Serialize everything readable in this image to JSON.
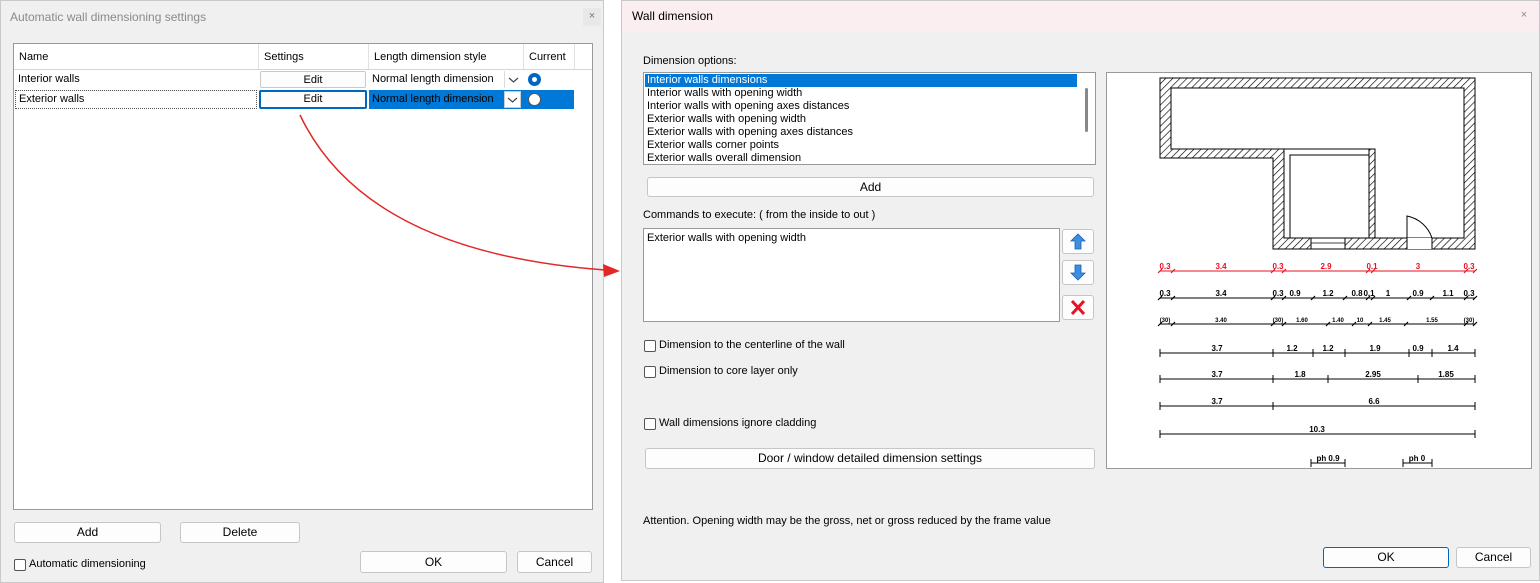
{
  "left": {
    "title": "Automatic wall dimensioning settings",
    "close": "×",
    "headers": [
      "Name",
      "Settings",
      "Length dimension style",
      "Current"
    ],
    "rows": [
      {
        "name": "Interior walls",
        "settings": "Edit",
        "style": "Normal length dimension",
        "current": true
      },
      {
        "name": "Exterior walls",
        "settings": "Edit",
        "style": "Normal length dimension",
        "current": false
      }
    ],
    "add": "Add",
    "delete": "Delete",
    "auto_dim": "Automatic dimensioning",
    "ok": "OK",
    "cancel": "Cancel"
  },
  "right": {
    "title": "Wall dimension",
    "close": "×",
    "dim_options_label": "Dimension options:",
    "options": [
      "Interior walls dimensions",
      "Interior walls with opening width",
      "Interior walls with opening axes distances",
      "Exterior walls with opening width",
      "Exterior walls with opening axes distances",
      "Exterior walls corner points",
      "Exterior walls overall dimension"
    ],
    "add": "Add",
    "commands_label": "Commands to execute: ( from the inside to out )",
    "commands": [
      "Exterior walls with opening width"
    ],
    "cb_centerline": "Dimension to the centerline of the wall",
    "cb_core": "Dimension to core layer only",
    "cb_cladding": "Wall dimensions ignore cladding",
    "door_window": "Door / window detailed dimension settings",
    "attention": "Attention. Opening width may be the gross, net or gross reduced by the frame value",
    "ok": "OK",
    "cancel": "Cancel"
  },
  "preview": {
    "row1": [
      "0.3",
      "3.4",
      "0.3",
      "2.9",
      "0.1",
      "3",
      "0.3"
    ],
    "row2": [
      "0.3",
      "3.4",
      "0.3",
      "0.9",
      "1.2",
      "0.8",
      "0.1",
      "1",
      "0.9",
      "1.1",
      "0.3"
    ],
    "row3": [
      "(30)",
      "3.40",
      "(30)",
      "1.60",
      "1.40",
      "10",
      "1.45",
      "1.55",
      "(30)"
    ],
    "row4": [
      "3.7",
      "1.2",
      "1.2",
      "1.9",
      "0.9",
      "1.4"
    ],
    "row5": [
      "3.7",
      "1.8",
      "2.95",
      "1.85"
    ],
    "row6": [
      "3.7",
      "6.6"
    ],
    "row7": [
      "10.3"
    ],
    "ph": [
      "ph 0.9",
      "ph 0"
    ]
  },
  "colors": {
    "accent": "#0078d7",
    "red": "#e81123",
    "arrow": "#e32626"
  }
}
